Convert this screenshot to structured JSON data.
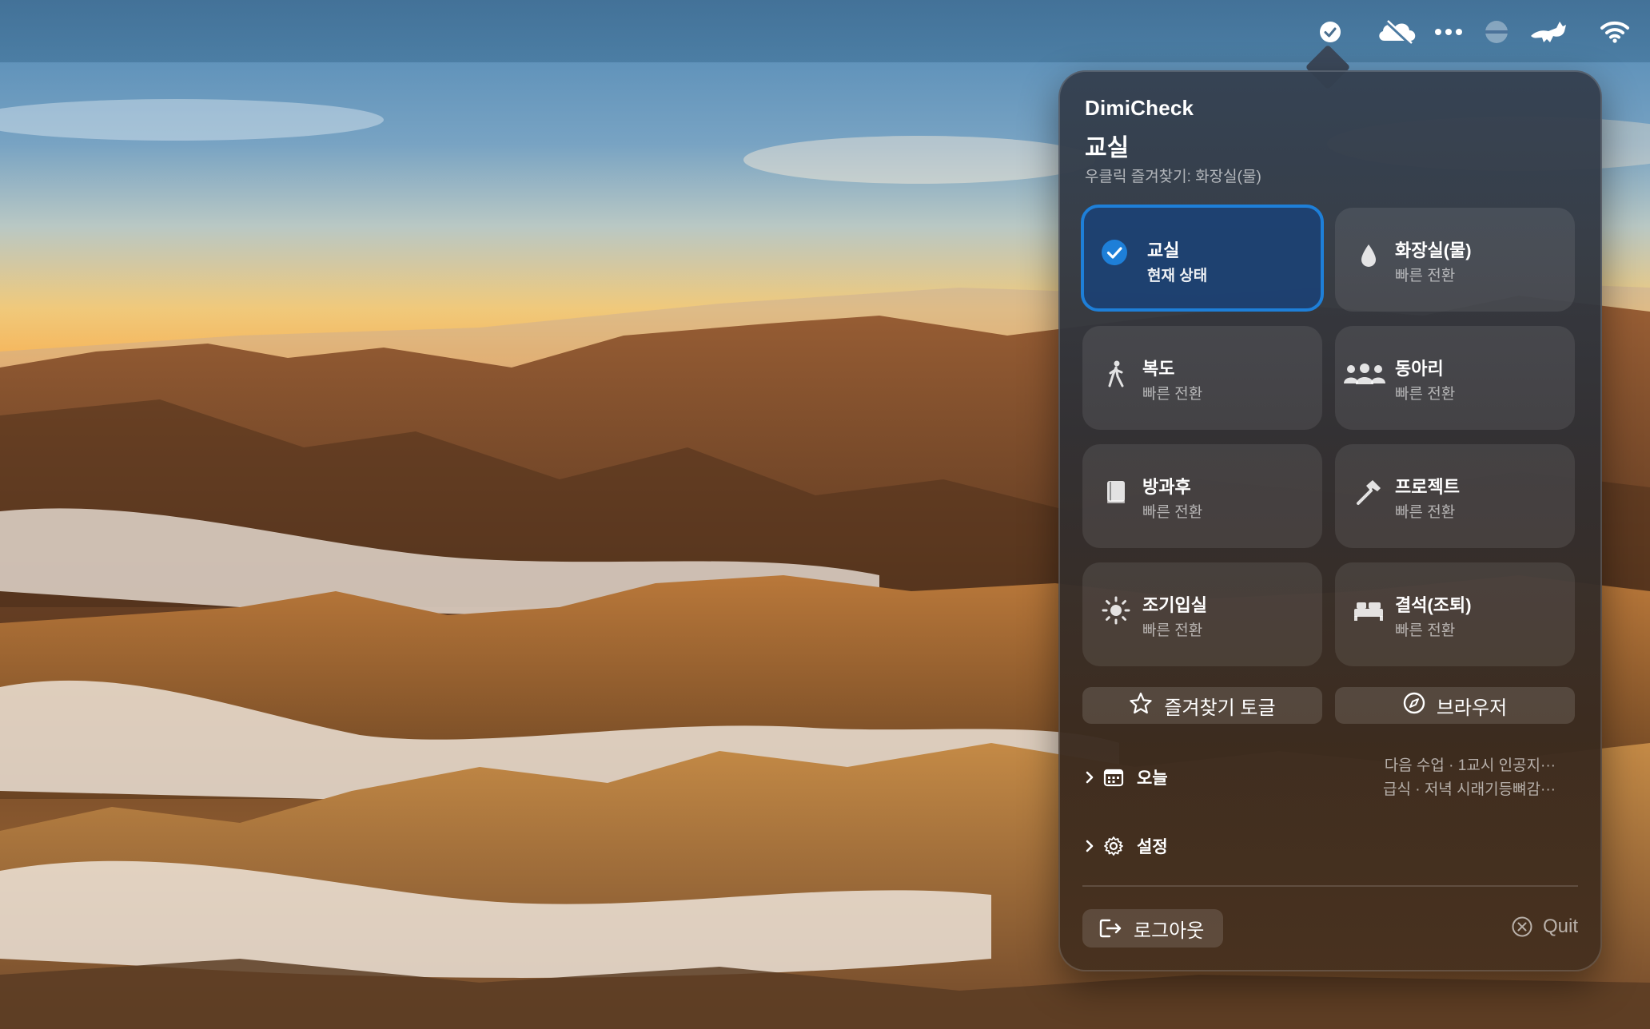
{
  "menubar": {
    "icons": [
      "dimicheck-check-icon",
      "cloud-slash-icon",
      "ellipsis-icon",
      "globe-icon",
      "runcat-icon",
      "wifi-icon"
    ]
  },
  "popover": {
    "app_title": "DimiCheck",
    "current_location": "교실",
    "favorite_hint": "우클릭 즐겨찾기: 화장실(물)",
    "tiles": [
      {
        "label": "교실",
        "sub": "현재 상태",
        "icon": "checkmark-circle-icon",
        "active": true
      },
      {
        "label": "화장실(물)",
        "sub": "빠른 전환",
        "icon": "drop-icon",
        "active": false
      },
      {
        "label": "복도",
        "sub": "빠른 전환",
        "icon": "walking-icon",
        "active": false
      },
      {
        "label": "동아리",
        "sub": "빠른 전환",
        "icon": "people-icon",
        "active": false
      },
      {
        "label": "방과후",
        "sub": "빠른 전환",
        "icon": "book-icon",
        "active": false
      },
      {
        "label": "프로젝트",
        "sub": "빠른 전환",
        "icon": "hammer-icon",
        "active": false
      },
      {
        "label": "조기입실",
        "sub": "빠른 전환",
        "icon": "sun-icon",
        "active": false
      },
      {
        "label": "결석(조퇴)",
        "sub": "빠른 전환",
        "icon": "bed-icon",
        "active": false
      }
    ],
    "favorite_toggle_label": "즐겨찾기 토글",
    "browser_label": "브라우저",
    "today": {
      "label": "오늘",
      "next_class": "다음 수업 · 1교시 인공지···",
      "meal": "급식 · 저녁 시래기등뼈감···"
    },
    "settings_label": "설정",
    "logout_label": "로그아웃",
    "quit_label": "Quit",
    "accent_color": "#1e7fd8"
  }
}
